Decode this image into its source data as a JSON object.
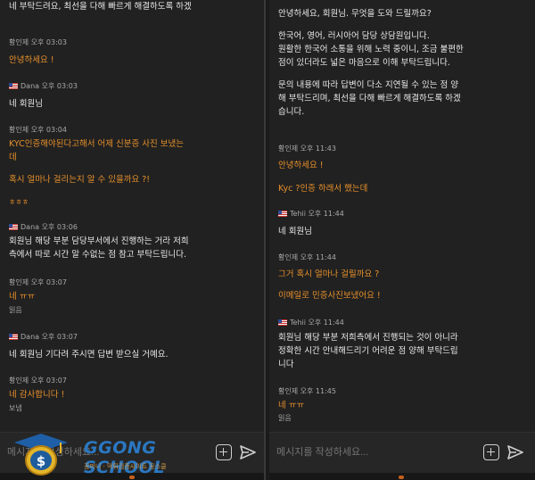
{
  "left": {
    "top_partial": "네 부탁드려요, 최선을 다해 빠르게 해결하도록 하겠",
    "messages": [
      {
        "sender": "황인제",
        "time": "오후 03:03",
        "flag": false,
        "lines": [
          "안녕하세요 !"
        ],
        "color": "orange"
      },
      {
        "sender": "Dana",
        "time": "오후 03:03",
        "flag": true,
        "lines": [
          "네 회원님"
        ],
        "color": "white"
      },
      {
        "sender": "황인제",
        "time": "오후 03:04",
        "flag": false,
        "lines": [
          "KYC인증해야된다고해서 어제 신분증 사진 보냈는",
          "데",
          "",
          "혹시 얼마나 걸리는지 알 수 있을까요 ?!",
          "",
          "ㅎㅎㅎ"
        ],
        "color": "orange"
      },
      {
        "sender": "Dana",
        "time": "오후 03:06",
        "flag": true,
        "lines": [
          "회원님 해당 부분 담당부서에서 진행하는 거라 저희",
          "측에서 따로 시간 알 수없는 점 참고 부탁드립니다."
        ],
        "color": "white"
      },
      {
        "sender": "황인제",
        "time": "오후 03:07",
        "flag": false,
        "lines": [
          "네 ㅠㅠ"
        ],
        "color": "orange",
        "status": "읽음"
      },
      {
        "sender": "Dana",
        "time": "오후 03:07",
        "flag": true,
        "lines": [
          "네 회원님 기다려 주시면 답변 받으실 거예요."
        ],
        "color": "white"
      },
      {
        "sender": "황인제",
        "time": "오후 03:07",
        "flag": false,
        "lines": [
          "네 감사합니다 !"
        ],
        "color": "orange",
        "status": "보냄"
      }
    ],
    "input_placeholder": "메시지를 작성하세요..."
  },
  "right": {
    "top_partial": "",
    "messages": [
      {
        "sender": "",
        "time": "",
        "flag": false,
        "lines": [
          "안녕하세요, 회원님. 무엇을 도와 드릴까요?",
          "",
          "한국어, 영어, 러시아어 담당 상담원입니다.",
          "원활한 한국어 소통을 위해 노력 중이니, 조금 불편한",
          "점이 있더라도 넓은 마음으로 이해 부탁드립니다.",
          "",
          "문의 내용에 따라 답변이 다소 지연될 수 있는 점 양",
          "해 부탁드리며, 최선을 다해 빠르게 해결하도록 하겠",
          "습니다."
        ],
        "color": "white"
      },
      {
        "sender": "황인제",
        "time": "오후 11:43",
        "flag": false,
        "lines": [
          "안녕하세요 !",
          "",
          "Kyc ?인증 하래서 했는데"
        ],
        "color": "orange"
      },
      {
        "sender": "Tehii",
        "time": "오후 11:44",
        "flag": true,
        "lines": [
          "네 회원님"
        ],
        "color": "white"
      },
      {
        "sender": "황인제",
        "time": "오후 11:44",
        "flag": false,
        "lines": [
          "그거 혹시 얼마나 걸릴까요 ?",
          "",
          "이메일로 민증사진보냈어요 !"
        ],
        "color": "orange"
      },
      {
        "sender": "Tehii",
        "time": "오후 11:44",
        "flag": true,
        "lines": [
          "회원님 해당 부분 저희측에서 진행되는 것이 아니라",
          "정확한 시간 안내해드리기 어려운 점 양해 부탁드립",
          "니다"
        ],
        "color": "white"
      },
      {
        "sender": "황인제",
        "time": "오후 11:45",
        "flag": false,
        "lines": [
          "네 ㅠㅠ"
        ],
        "color": "orange",
        "status": "읽음"
      }
    ],
    "input_placeholder": "메시지를 작성하세요..."
  },
  "watermark": {
    "title": "GGONG SCHOOL",
    "subtitle": "꽁머니 · 먹튀검증사이트 꽁스쿨"
  },
  "colors": {
    "background": "#212121",
    "customer_text": "#e7902b",
    "agent_text": "#e8e8e8",
    "meta_text": "#a9a9a9",
    "watermark_blue": "#2a78c2"
  },
  "icons": {
    "attach": "plus-square-icon",
    "send": "send-arrow-icon",
    "flag": "us-flag-icon"
  }
}
